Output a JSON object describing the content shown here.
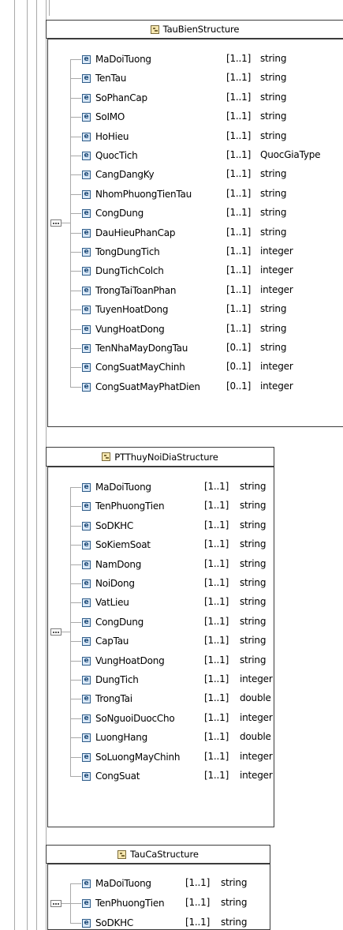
{
  "structures": [
    {
      "title": "TauBienStructure",
      "elements": [
        {
          "name": "MaDoiTuong",
          "card": "[1..1]",
          "type": "string"
        },
        {
          "name": "TenTau",
          "card": "[1..1]",
          "type": "string"
        },
        {
          "name": "SoPhanCap",
          "card": "[1..1]",
          "type": "string"
        },
        {
          "name": "SoIMO",
          "card": "[1..1]",
          "type": "string"
        },
        {
          "name": "HoHieu",
          "card": "[1..1]",
          "type": "string"
        },
        {
          "name": "QuocTich",
          "card": "[1..1]",
          "type": "QuocGiaType"
        },
        {
          "name": "CangDangKy",
          "card": "[1..1]",
          "type": "string"
        },
        {
          "name": "NhomPhuongTienTau",
          "card": "[1..1]",
          "type": "string"
        },
        {
          "name": "CongDung",
          "card": "[1..1]",
          "type": "string"
        },
        {
          "name": "DauHieuPhanCap",
          "card": "[1..1]",
          "type": "string"
        },
        {
          "name": "TongDungTich",
          "card": "[1..1]",
          "type": "integer"
        },
        {
          "name": "DungTichColch",
          "card": "[1..1]",
          "type": "integer"
        },
        {
          "name": "TrongTaiToanPhan",
          "card": "[1..1]",
          "type": "integer"
        },
        {
          "name": "TuyenHoatDong",
          "card": "[1..1]",
          "type": "string"
        },
        {
          "name": "VungHoatDong",
          "card": "[1..1]",
          "type": "string"
        },
        {
          "name": "TenNhaMayDongTau",
          "card": "[0..1]",
          "type": "string"
        },
        {
          "name": "CongSuatMayChinh",
          "card": "[0..1]",
          "type": "integer"
        },
        {
          "name": "CongSuatMayPhatDien",
          "card": "[0..1]",
          "type": "integer"
        }
      ]
    },
    {
      "title": "PTThuyNoiDiaStructure",
      "elements": [
        {
          "name": "MaDoiTuong",
          "card": "[1..1]",
          "type": "string"
        },
        {
          "name": "TenPhuongTien",
          "card": "[1..1]",
          "type": "string"
        },
        {
          "name": "SoDKHC",
          "card": "[1..1]",
          "type": "string"
        },
        {
          "name": "SoKiemSoat",
          "card": "[1..1]",
          "type": "string"
        },
        {
          "name": "NamDong",
          "card": "[1..1]",
          "type": "string"
        },
        {
          "name": "NoiDong",
          "card": "[1..1]",
          "type": "string"
        },
        {
          "name": "VatLieu",
          "card": "[1..1]",
          "type": "string"
        },
        {
          "name": "CongDung",
          "card": "[1..1]",
          "type": "string"
        },
        {
          "name": "CapTau",
          "card": "[1..1]",
          "type": "string"
        },
        {
          "name": "VungHoatDong",
          "card": "[1..1]",
          "type": "string"
        },
        {
          "name": "DungTich",
          "card": "[1..1]",
          "type": "integer"
        },
        {
          "name": "TrongTai",
          "card": "[1..1]",
          "type": "double"
        },
        {
          "name": "SoNguoiDuocCho",
          "card": "[1..1]",
          "type": "integer"
        },
        {
          "name": "LuongHang",
          "card": "[1..1]",
          "type": "double"
        },
        {
          "name": "SoLuongMayChinh",
          "card": "[1..1]",
          "type": "integer"
        },
        {
          "name": "CongSuat",
          "card": "[1..1]",
          "type": "integer"
        }
      ]
    },
    {
      "title": "TauCaStructure",
      "elements": [
        {
          "name": "MaDoiTuong",
          "card": "[1..1]",
          "type": "string"
        },
        {
          "name": "TenPhuongTien",
          "card": "[1..1]",
          "type": "string"
        },
        {
          "name": "SoDKHC",
          "card": "[1..1]",
          "type": "string"
        }
      ]
    }
  ]
}
